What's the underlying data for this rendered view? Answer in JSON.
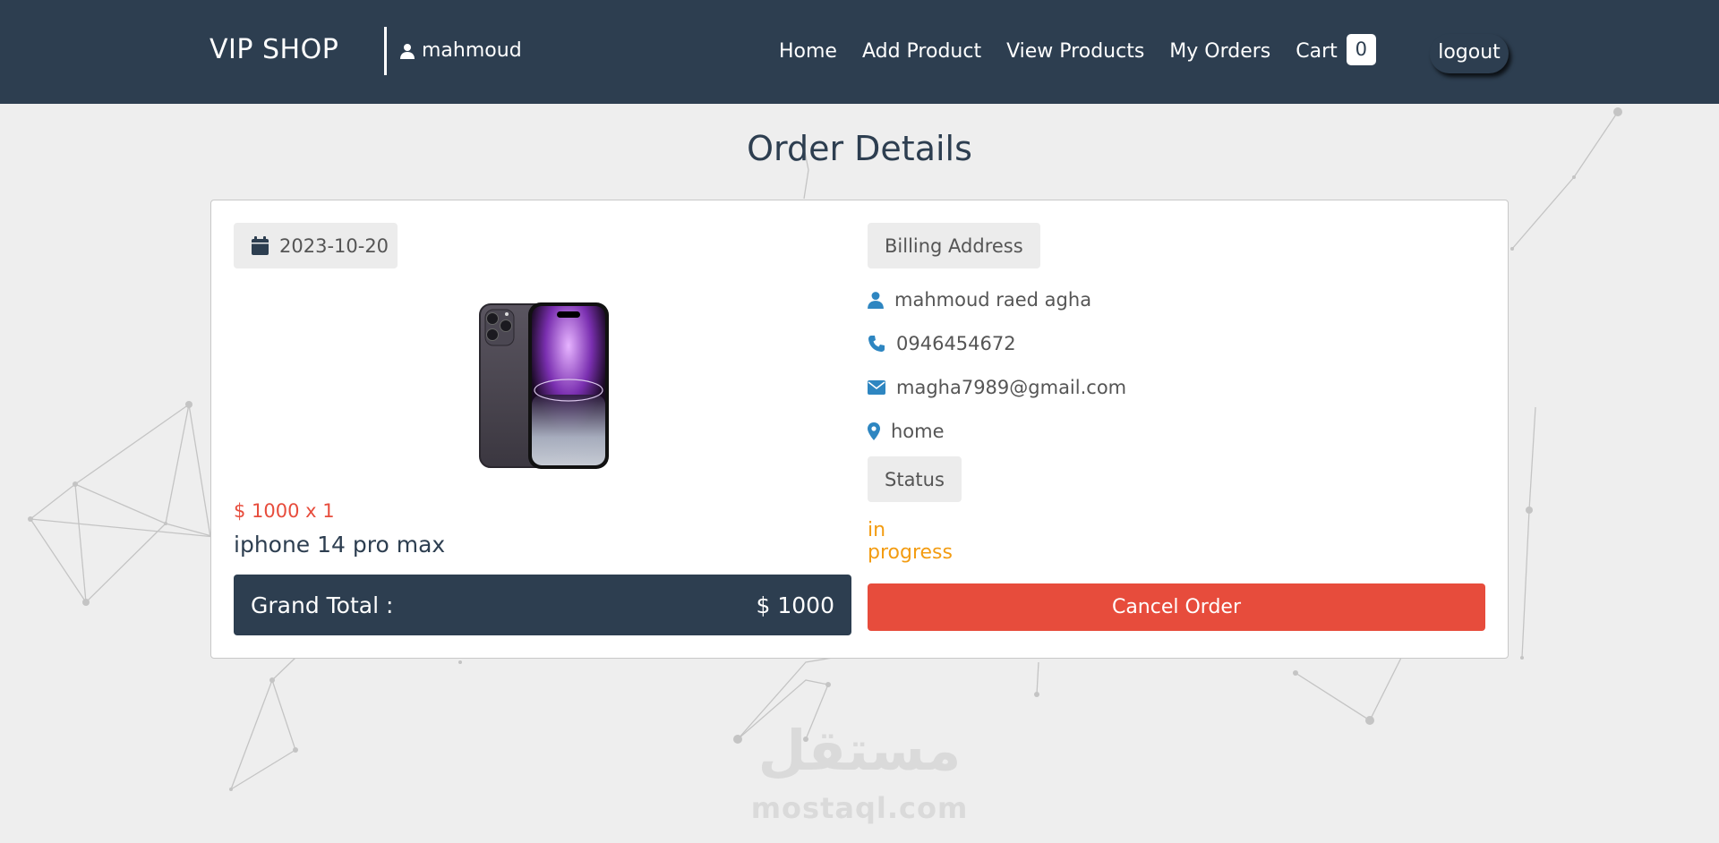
{
  "navbar": {
    "brand": "VIP SHOP",
    "username": "mahmoud",
    "links": [
      "Home",
      "Add Product",
      "View Products",
      "My Orders"
    ],
    "cart_label": "Cart",
    "cart_count": "0",
    "logout_label": "logout"
  },
  "page": {
    "title": "Order Details"
  },
  "order": {
    "date": "2023-10-20",
    "price_line": "$ 1000 x 1",
    "product_name": "iphone 14 pro max",
    "grand_total_label": "Grand Total :",
    "grand_total_value": "$ 1000"
  },
  "billing": {
    "title": "Billing Address",
    "name": "mahmoud raed agha",
    "phone": "0946454672",
    "email": "magha7989@gmail.com",
    "address": "home",
    "status_label": "Status",
    "status_value": "in progress",
    "cancel_label": "Cancel Order"
  },
  "watermark": {
    "arabic": "مستقل",
    "latin": "mostaql.com"
  },
  "colors": {
    "navbar": "#2d3e50",
    "danger": "#e74c3c",
    "warning": "#f39c12",
    "icon_blue": "#2e86c1",
    "background": "#eeeeee"
  }
}
